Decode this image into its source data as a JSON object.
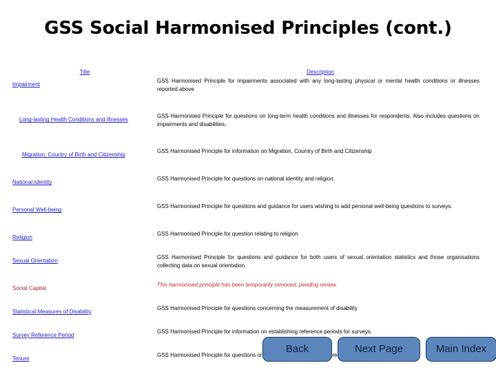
{
  "slide": {
    "title": "GSS Social Harmonised Principles (cont.)"
  },
  "table": {
    "headers": {
      "title": "Title",
      "description": "Description"
    },
    "rows": [
      {
        "title": "Impairment",
        "description": "GSS Harmonised Principle for impairments associated with any long-lasting physical or mental health conditions or illnesses reported above",
        "is_link": true,
        "removed": false
      },
      {
        "title": "Long-lasting Health Conditions and Illnesses",
        "description": "GSS Harmonised Principle for questions on long-term health conditions and illnesses for respondents. Also includes questions on impairments and disabilities.",
        "is_link": true,
        "removed": false
      },
      {
        "title": "Migration, Country of Birth and Citizenship",
        "description": "GSS Harmonised Principle for information on Migration, Country of Birth and Citizenship",
        "is_link": true,
        "removed": false
      },
      {
        "title": "National Identity",
        "description": "GSS Harmonised Principle for questions on national identity and religion.",
        "is_link": true,
        "removed": false
      },
      {
        "title": "Personal Well-being",
        "description": "GSS Harmonised Principle for questions and guidance for users wishing to add personal well-being questions to surveys.",
        "is_link": true,
        "removed": false
      },
      {
        "title": "Religion",
        "description": "GSS Harmonised Principle for question relating to religion",
        "is_link": true,
        "removed": false
      },
      {
        "title": "Sexual Orientation",
        "description": "GSS Harmonised Principle for questions and guidance for both users of sexual orientation statistics and those organisations collecting data on sexual orientation.",
        "is_link": true,
        "removed": false
      },
      {
        "title": "Social Capital",
        "description": "This harmonised principle has been temporarily removed, pending review.",
        "is_link": false,
        "removed": true
      },
      {
        "title": "Statistical Measures of Disability",
        "description": "GSS Harmonised Principle  for questions concerning the measurement of disability",
        "is_link": true,
        "removed": false
      },
      {
        "title": "Survey Reference Period",
        "description": "GSS Harmonised Principle for information on establishing reference periods for surveys.",
        "is_link": true,
        "removed": false
      },
      {
        "title": "Tenure",
        "description": "GSS Harmonised Principle for questions on ownership, or otherwise, of respondent's accommodation.",
        "is_link": true,
        "removed": false
      }
    ]
  },
  "buttons": {
    "back": "Back",
    "next_page": "Next Page",
    "main_index": "Main Index"
  },
  "colors": {
    "link": "#1b1bc4",
    "removed_text": "#c22b2b",
    "removed_title": "#b32020",
    "button_fill": "#5b87bd",
    "button_border": "#1f3a63",
    "background": "#ffffff"
  }
}
